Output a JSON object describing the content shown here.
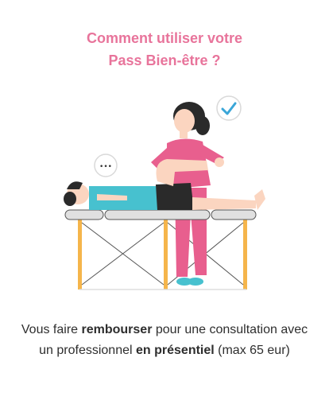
{
  "header": {
    "title_line1": "Comment utiliser votre",
    "title_line2": "Pass Bien-être ?"
  },
  "caption": {
    "part1": "Vous faire ",
    "bold1": "rembourser",
    "part2": " pour une consultation avec un professionnel ",
    "bold2": "en présentiel",
    "part3": " (max 65 eur)"
  },
  "illustration": {
    "thought_bubble_text": "•••",
    "colors": {
      "accent_pink": "#e8749b",
      "scrubs": "#e85f8e",
      "patient_shirt": "#47c1cf",
      "table_legs": "#f5b54b",
      "check": "#3aa6d8"
    }
  }
}
